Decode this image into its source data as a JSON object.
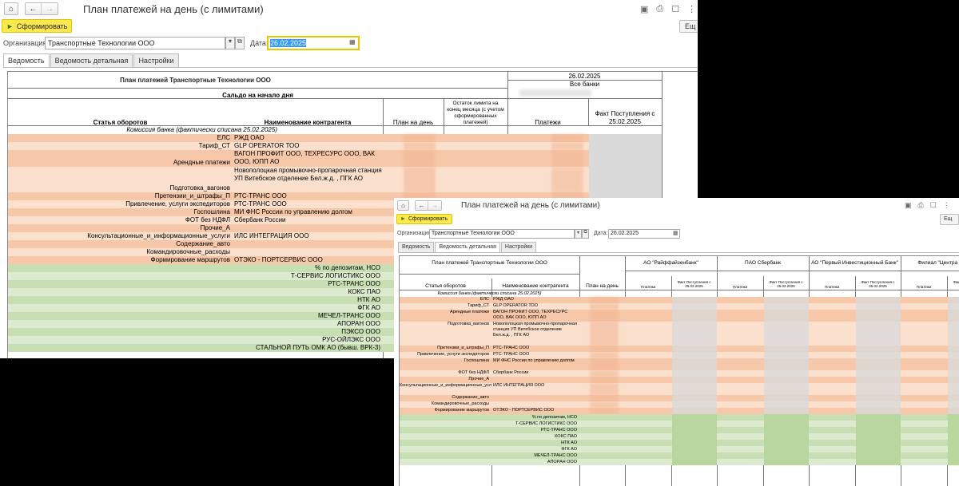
{
  "colors": {
    "orange_row": "#f6c7a8",
    "orange_light": "#fbe0cd",
    "green_row": "#c7dfb2",
    "green_light": "#dcebcf",
    "gray_cell": "#dadada",
    "accent_yellow": "#fce94f"
  },
  "window": {
    "title": "План платежей на день (с лимитами)",
    "generate_label": "Сформировать",
    "ext_label": "Ещ",
    "org_label": "Организация:",
    "org_value": "Транспортные Технологии ООО",
    "date_label": "Дата:",
    "date_value": "26.02.2025",
    "tabs": [
      "Ведомость",
      "Ведомость детальная",
      "Настройки"
    ]
  },
  "report1": {
    "header_title": "План платежей Транспортные Технологии ООО",
    "date_header": "26.02.2025",
    "all_banks": "Все банки",
    "saldo_label": "Сальдо на начало дня",
    "col_article": "Статья оборотов",
    "col_counterparty": "Наименование контрагента",
    "col_plan": "План на день",
    "col_limit": "Остаток лимита на конец месяца (с учетом сформированных платежей)",
    "col_payments": "Платежи",
    "col_fact": "Факт Поступления с 25.02.2025",
    "commission": "Комиссия банка (фактически списана 25.02.2025)",
    "rows": [
      {
        "article": "ЕЛС",
        "counterparty": "РЖД ОАО",
        "tone": "orange"
      },
      {
        "article": "Тариф_СТ",
        "counterparty": "GLP OPERATOR ТОО",
        "tone": "orange"
      },
      {
        "article": "Арендные платежи",
        "counterparty": "ВАГОН ПРОФИТ ООО, ТЕХРЕСУРС ООО, ВАК ООО, ЮПП АО",
        "tone": "orange2"
      },
      {
        "article": "Подготовка_вагонов",
        "counterparty": "Новополоцкая промывочно-пропарочная станция УП Витебское отделение Бел.ж.д. , ПГК АО",
        "tone": "orange3"
      },
      {
        "article": "Претензии_и_штрафы_П",
        "counterparty": "РТС-ТРАНС ООО",
        "tone": "orange"
      },
      {
        "article": "Привлечение, услуги экспедиторов",
        "counterparty": "РТС-ТРАНС ООО",
        "tone": "orange"
      },
      {
        "article": "Госпошлина",
        "counterparty": "МИ ФНС России по управлению долгом",
        "tone": "orange"
      },
      {
        "article": "ФОТ без НДФЛ",
        "counterparty": "Сбербанк России",
        "tone": "orange"
      },
      {
        "article": "Прочие_А",
        "counterparty": "",
        "tone": "orange"
      },
      {
        "article": "Консультационные_и_информационные_услуги",
        "counterparty": "ИЛС ИНТЕГРАЦИЯ ООО",
        "tone": "orange"
      },
      {
        "article": "Содержание_авто",
        "counterparty": "",
        "tone": "orange"
      },
      {
        "article": "Командировочные_расходы",
        "counterparty": "",
        "tone": "orange"
      },
      {
        "article": "Формирование маршрутов",
        "counterparty": "ОТЭКО - ПОРТСЕРВИС ООО",
        "tone": "orange"
      }
    ],
    "green_rows": [
      "% по депозитам, НСО",
      "Т-СЕРВИС ЛОГИСТИКС ООО",
      "РТС-ТРАНС ООО",
      "КОКС ПАО",
      "НТК АО",
      "ФГК АО",
      "МЕЧЕЛ-ТРАНС ООО",
      "АПОРАН ООО",
      "ПЭКСО ООО",
      "РУС-ОЙЛЭКС ООО",
      "СТАЛЬНОЙ ПУТЬ ОМК АО (бывш. ВРК-3)"
    ]
  },
  "report2": {
    "header_title": "План платежей Транспортные Технологии ООО",
    "col_article": "Статья оборотов",
    "col_counterparty": "Наименование контрагента",
    "col_plan": "План на день",
    "banks": [
      "АО \"Райффайзенбанк\"",
      "ПАО Сбербанк",
      "АО \"Первый Инвестиционный Банк\"",
      "Филиал \"Центра ВТБ (П"
    ],
    "sub_payments": "Платежи",
    "sub_fact": "Факт Поступления с 25.02.2025",
    "commission": "Комиссия банка (фактически списана 25.02.2025)",
    "rows": [
      {
        "article": "ЕЛС",
        "counterparty": "РЖД ОАО",
        "tone": "orange"
      },
      {
        "article": "Тариф_СТ",
        "counterparty": "GLP OPERATOR ТОО",
        "tone": "orange"
      },
      {
        "article": "Арендные платежи",
        "counterparty": "ВАГОН ПРОФИТ ООО, ТЕХРЕСУРС ООО, ВАК ООО, ЮПП АО",
        "tone": "orange2"
      },
      {
        "article": "Подготовка_вагонов",
        "counterparty": "Новополоцкая промывочно-пропарочная станция УП Витебское отделение Бел.ж.д. , ПГК АО",
        "tone": "orange4"
      },
      {
        "article": "Претензии_и_штрафы_П",
        "counterparty": "РТС-ТРАНС ООО",
        "tone": "orange"
      },
      {
        "article": "Привлечение, услуги экспедиторов",
        "counterparty": "РТС-ТРАНС ООО",
        "tone": "orange"
      },
      {
        "article": "Госпошлина",
        "counterparty": "МИ ФНС России по управлению долгом",
        "tone": "orange2"
      },
      {
        "article": "ФОТ без НДФЛ",
        "counterparty": "Сбербанк России",
        "tone": "orange"
      },
      {
        "article": "Прочие_А",
        "counterparty": "",
        "tone": "orange"
      },
      {
        "article": "Консультационные_и_информационные_услуги",
        "counterparty": "ИЛС ИНТЕГРАЦИЯ ООО",
        "tone": "orange3"
      },
      {
        "article": "Содержание_авто",
        "counterparty": "",
        "tone": "orange"
      },
      {
        "article": "Командировочные_расходы",
        "counterparty": "",
        "tone": "orange"
      },
      {
        "article": "Формирование маршрутов",
        "counterparty": "ОТЭКО - ПОРТСЕРВИС ООО",
        "tone": "orange"
      }
    ],
    "green_rows": [
      "% по депозитам, НСО",
      "Т-СЕРВИС ЛОГИСТИКС ООО",
      "РТС-ТРАНС ООО",
      "КОКС ПАО",
      "НТК АО",
      "ФГК АО",
      "МЕЧЕЛ-ТРАНС ООО",
      "АПОРАН ООО"
    ]
  }
}
